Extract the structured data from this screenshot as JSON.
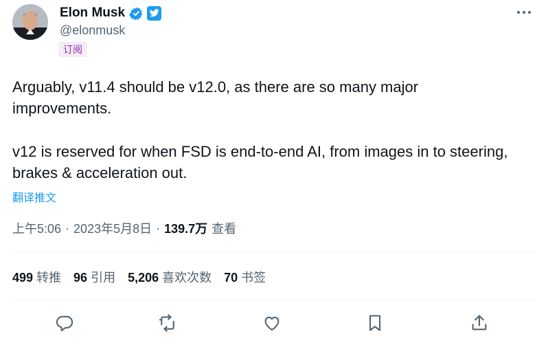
{
  "author": {
    "name": "Elon Musk",
    "handle": "@elonmusk",
    "subscribe_label": "订阅",
    "verified_icon": "verified-badge-icon",
    "platform_icon": "twitter-bird-icon"
  },
  "tweet": {
    "paragraphs": [
      "Arguably, v11.4 should be v12.0, as there are so many major improvements.",
      "v12 is reserved for when FSD is end-to-end AI, from images in to steering, brakes & acceleration out."
    ],
    "translate_label": "翻译推文"
  },
  "meta": {
    "time": "上午5:06",
    "date": "2023年5月8日",
    "separator": "·",
    "views_count": "139.7万",
    "views_label": "查看"
  },
  "stats": {
    "retweets": {
      "count": "499",
      "label": "转推"
    },
    "quotes": {
      "count": "96",
      "label": "引用"
    },
    "likes": {
      "count": "5,206",
      "label": "喜欢次数"
    },
    "bookmarks": {
      "count": "70",
      "label": "书签"
    }
  },
  "colors": {
    "accent": "#1d9bf0",
    "text": "#0f1419",
    "secondary": "#536471",
    "subscribe_bg": "#f4ecf7",
    "subscribe_fg": "#8a2bb0",
    "verified_gold": "#1d9bf0"
  },
  "actions": [
    "reply-icon",
    "retweet-icon",
    "like-icon",
    "bookmark-icon",
    "share-icon"
  ]
}
